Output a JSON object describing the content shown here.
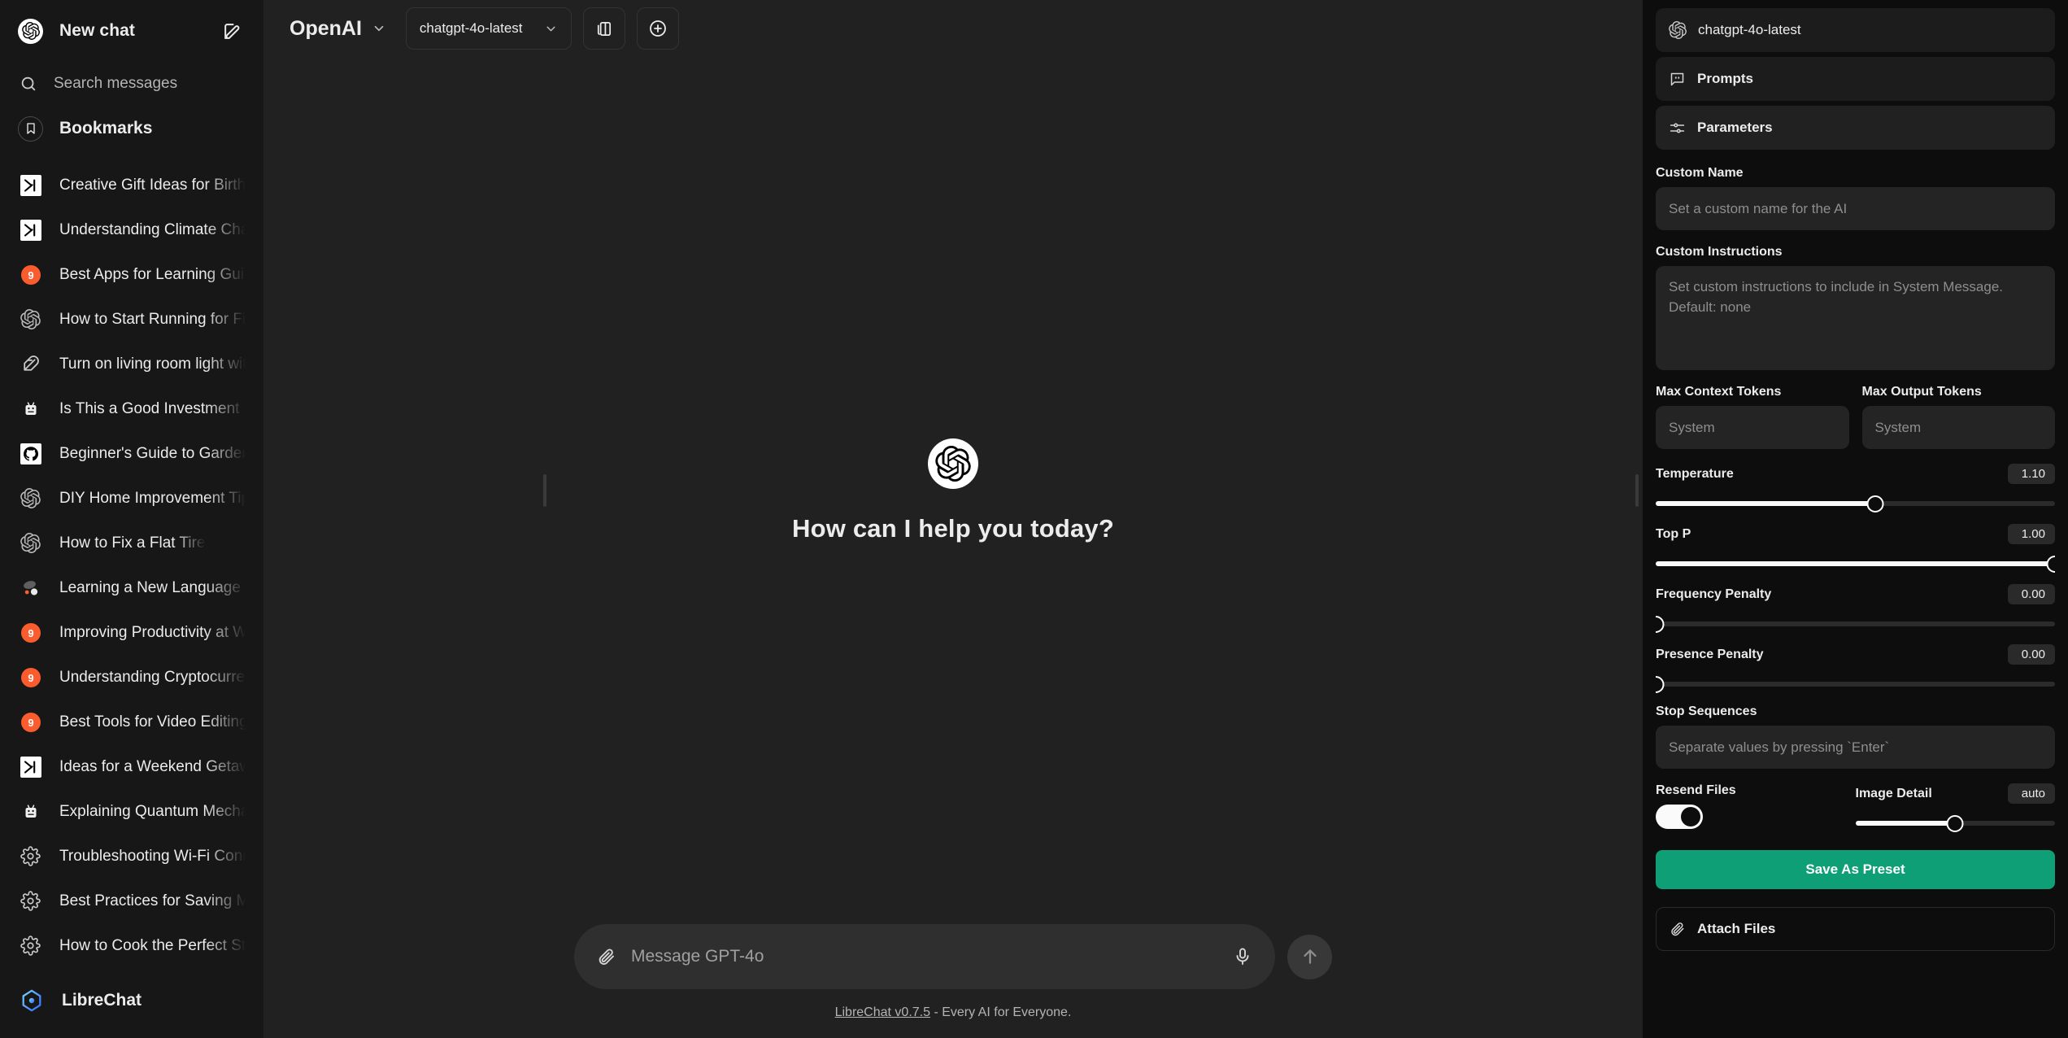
{
  "sidebar": {
    "new_chat_label": "New chat",
    "new_chat_icon": "openai-logo-icon",
    "edit_icon": "pencil-square-icon",
    "search_placeholder": "Search messages",
    "search_icon": "search-icon",
    "bookmarks_label": "Bookmarks",
    "bookmarks_icon": "bookmark-icon",
    "app_name": "LibreChat",
    "app_icon": "librechat-logo-icon",
    "conversations": [
      {
        "title": "Creative Gift Ideas for Birthda",
        "icon": "xai-icon"
      },
      {
        "title": "Understanding Climate Chang",
        "icon": "xai-icon"
      },
      {
        "title": "Best Apps for Learning Guitar",
        "icon": "mistral-icon"
      },
      {
        "title": "How to Start Running for Fitne",
        "icon": "openai-icon"
      },
      {
        "title": "Turn on living room light with",
        "icon": "feather-icon"
      },
      {
        "title": "Is This a Good Investment Op",
        "icon": "anthropic-icon"
      },
      {
        "title": "Beginner's Guide to Gardenin",
        "icon": "github-icon"
      },
      {
        "title": "DIY Home Improvement Tips",
        "icon": "openai-icon"
      },
      {
        "title": "How to Fix a Flat Tire",
        "icon": "openai-icon"
      },
      {
        "title": "Learning a New Language Qu",
        "icon": "google-gemini-icon"
      },
      {
        "title": "Improving Productivity at Wor",
        "icon": "mistral-icon"
      },
      {
        "title": "Understanding Cryptocurrenc",
        "icon": "mistral-icon"
      },
      {
        "title": "Best Tools for Video Editing",
        "icon": "mistral-icon"
      },
      {
        "title": "Ideas for a Weekend Getaway",
        "icon": "xai-icon"
      },
      {
        "title": "Explaining Quantum Mechanic",
        "icon": "anthropic-icon"
      },
      {
        "title": "Troubleshooting Wi-Fi Conne",
        "icon": "settings-icon"
      },
      {
        "title": "Best Practices for Saving Mon",
        "icon": "settings-icon"
      },
      {
        "title": "How to Cook the Perfect Stea",
        "icon": "settings-icon"
      }
    ]
  },
  "topbar": {
    "provider_label": "OpenAI",
    "provider_chevron_icon": "chevron-down-icon",
    "model_value": "chatgpt-4o-latest",
    "model_chevron_icon": "chevron-down-icon",
    "compare_icon": "duplicate-panes-icon",
    "add_icon": "plus-circle-icon"
  },
  "canvas": {
    "logo_icon": "openai-logo-icon",
    "greeting": "How can I help you today?"
  },
  "composer": {
    "attach_icon": "paperclip-icon",
    "placeholder": "Message GPT-4o",
    "mic_icon": "microphone-icon",
    "send_icon": "arrow-up-icon"
  },
  "footer": {
    "link_text": "LibreChat v0.7.5",
    "rest_text": " - Every AI for Everyone."
  },
  "panel": {
    "model_card_label": "chatgpt-4o-latest",
    "model_card_icon": "openai-icon",
    "prompts_label": "Prompts",
    "prompts_icon": "chat-quote-icon",
    "parameters_label": "Parameters",
    "parameters_icon": "sliders-icon",
    "custom_name_label": "Custom Name",
    "custom_name_placeholder": "Set a custom name for the AI",
    "custom_instructions_label": "Custom Instructions",
    "custom_instructions_placeholder": "Set custom instructions to include in System Message. Default: none",
    "max_context_label": "Max Context Tokens",
    "max_context_placeholder": "System",
    "max_output_label": "Max Output Tokens",
    "max_output_placeholder": "System",
    "sliders": [
      {
        "name": "Temperature",
        "value": "1.10",
        "percent": 55
      },
      {
        "name": "Top P",
        "value": "1.00",
        "percent": 100
      },
      {
        "name": "Frequency Penalty",
        "value": "0.00",
        "percent": 0
      },
      {
        "name": "Presence Penalty",
        "value": "0.00",
        "percent": 0
      }
    ],
    "stop_sequences_label": "Stop Sequences",
    "stop_sequences_placeholder": "Separate values by pressing `Enter`",
    "resend_files_label": "Resend Files",
    "resend_files_on": true,
    "image_detail_label": "Image Detail",
    "image_detail_value": "auto",
    "image_detail_percent": 50,
    "save_preset_label": "Save As Preset",
    "attach_files_label": "Attach Files",
    "attach_files_icon": "paperclip-icon"
  },
  "colors": {
    "sidebar_bg": "#171717",
    "main_bg": "#212121",
    "panel_bg": "#0d0d0d",
    "accent_green": "#0e9f77",
    "accent_orange": "#fa5c2e",
    "text_primary": "#ececec"
  }
}
